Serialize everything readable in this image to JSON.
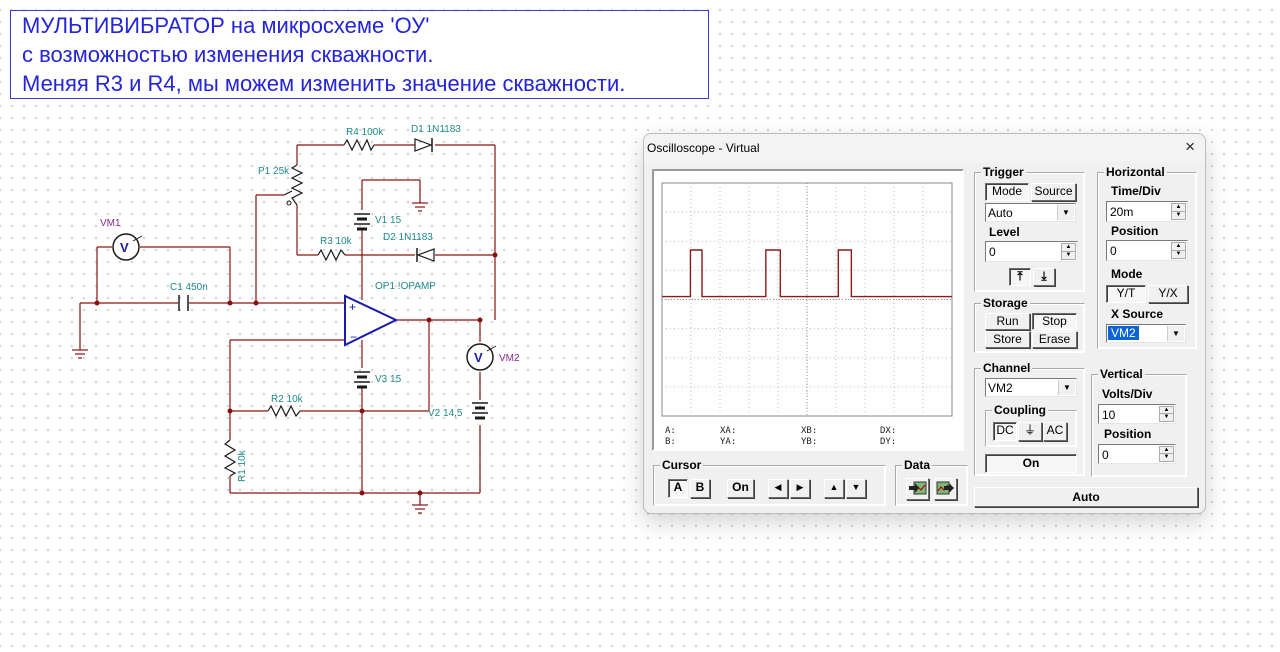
{
  "heading": {
    "line1": "МУЛЬТИВИБРАТОР на микросхеме 'ОУ'",
    "line2": "с возможностью изменения скважности.",
    "line3": "Меняя R3 и R4, мы можем изменить значение скважности."
  },
  "circuit": {
    "labels": {
      "vm1": "VM1",
      "vm2": "VM2",
      "c1": "C1 450n",
      "p1": "P1 25k",
      "r4": "R4 100k",
      "d1": "D1 1N1183",
      "v1": "V1 15",
      "r3": "R3 10k",
      "d2": "D2 1N1183",
      "op1": "OP1 !OPAMP",
      "v3": "V3 15",
      "r2": "R2 10k",
      "v2": "V2 14,5",
      "r1": "R1 10k",
      "meter_symbol": "V"
    }
  },
  "oscilloscope": {
    "window_title": "Oscilloscope - Virtual",
    "close_icon": "×",
    "trace_color": "#8b1a1a",
    "waveform": {
      "type": "pulse-train",
      "low_level_div": 0.0,
      "high_level_div": 1.7,
      "pulses": [
        [
          0.98,
          1.38
        ],
        [
          3.58,
          4.08
        ],
        [
          6.08,
          6.53
        ]
      ],
      "x_div_count": 10,
      "y_div_count": 8
    },
    "readouts": {
      "a": "A:",
      "b": "B:",
      "xa": "XA:",
      "ya": "YA:",
      "xb": "XB:",
      "yb": "YB:",
      "dx": "DX:",
      "dy": "DY:"
    },
    "trigger": {
      "title": "Trigger",
      "mode_tab": "Mode",
      "source_tab": "Source",
      "mode_value": "Auto",
      "level_label": "Level",
      "level_value": "0",
      "rising_edge_icon": "⤒",
      "falling_edge_icon": "⤓"
    },
    "horizontal": {
      "title": "Horizontal",
      "time_div_label": "Time/Div",
      "time_div_value": "20m",
      "position_label": "Position",
      "position_value": "0",
      "mode_label": "Mode",
      "mode_yt": "Y/T",
      "mode_yx": "Y/X",
      "xsource_label": "X Source",
      "xsource_value": "VM2"
    },
    "storage": {
      "title": "Storage",
      "run": "Run",
      "stop": "Stop",
      "store": "Store",
      "erase": "Erase"
    },
    "channel": {
      "title": "Channel",
      "value": "VM2",
      "coupling_title": "Coupling",
      "dc": "DC",
      "ground": "⏚",
      "ac": "AC",
      "on_label": "On"
    },
    "vertical": {
      "title": "Vertical",
      "volts_div_label": "Volts/Div",
      "volts_div_value": "10",
      "position_label": "Position",
      "position_value": "0"
    },
    "cursor": {
      "title": "Cursor",
      "a": "A",
      "b": "B",
      "on": "On",
      "left": "◀",
      "right": "▶",
      "up": "▲",
      "down": "▼"
    },
    "data": {
      "title": "Data"
    },
    "auto_button": "Auto"
  }
}
